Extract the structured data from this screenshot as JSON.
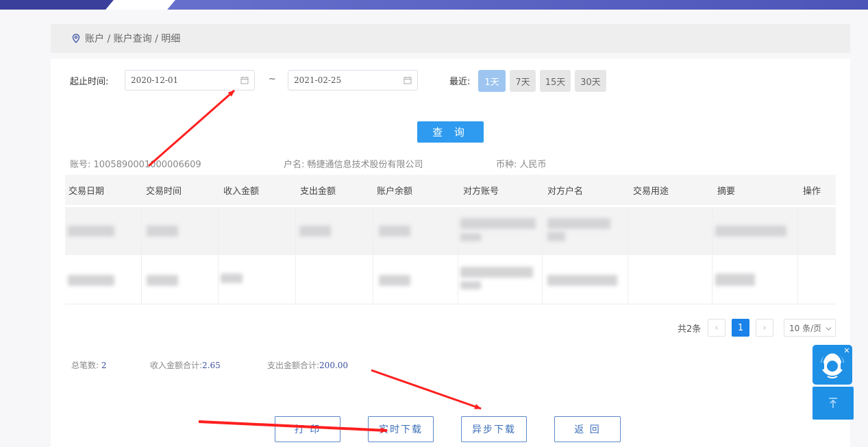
{
  "breadcrumb": {
    "text": "账户 / 账户查询 / 明细"
  },
  "filter": {
    "label_range": "起止时间:",
    "start_date": "2020-12-01",
    "separator": "~",
    "end_date": "2021-02-25",
    "label_recent": "最近:",
    "quick_options": [
      "1天",
      "7天",
      "15天",
      "30天"
    ],
    "query_label": "查 询"
  },
  "account": {
    "number": "账号: 1005890001000006609",
    "name": "户名: 畅捷通信息技术股份有限公司",
    "currency": "币种: 人民币"
  },
  "table": {
    "headers": [
      "交易日期",
      "交易时间",
      "收入金额",
      "支出金额",
      "账户余额",
      "对方账号",
      "对方户名",
      "交易用途",
      "摘要",
      "操作"
    ]
  },
  "pagination": {
    "total": "共2条",
    "prev": "‹",
    "current": "1",
    "next": "›",
    "page_size": "10 条/页"
  },
  "summary": {
    "count_label": "总笔数:",
    "count_value": "2",
    "income_label": "收入金额合计:",
    "income_value": "2.65",
    "expense_label": "支出金额合计:",
    "expense_value": "200.00"
  },
  "actions": {
    "print": "打 印",
    "realtime_download": "实时下载",
    "async_download": "异步下载",
    "back": "返 回"
  },
  "colors": {
    "primary": "#2e9bf0",
    "accent_blue": "#1a82e8",
    "annotation_arrow": "#ff1f1f",
    "header_bar": "#5c63c4"
  },
  "icons": [
    "location-pin-icon",
    "calendar-icon",
    "customer-service-icon",
    "close-icon",
    "arrow-up-icon",
    "chevron-down-icon"
  ]
}
